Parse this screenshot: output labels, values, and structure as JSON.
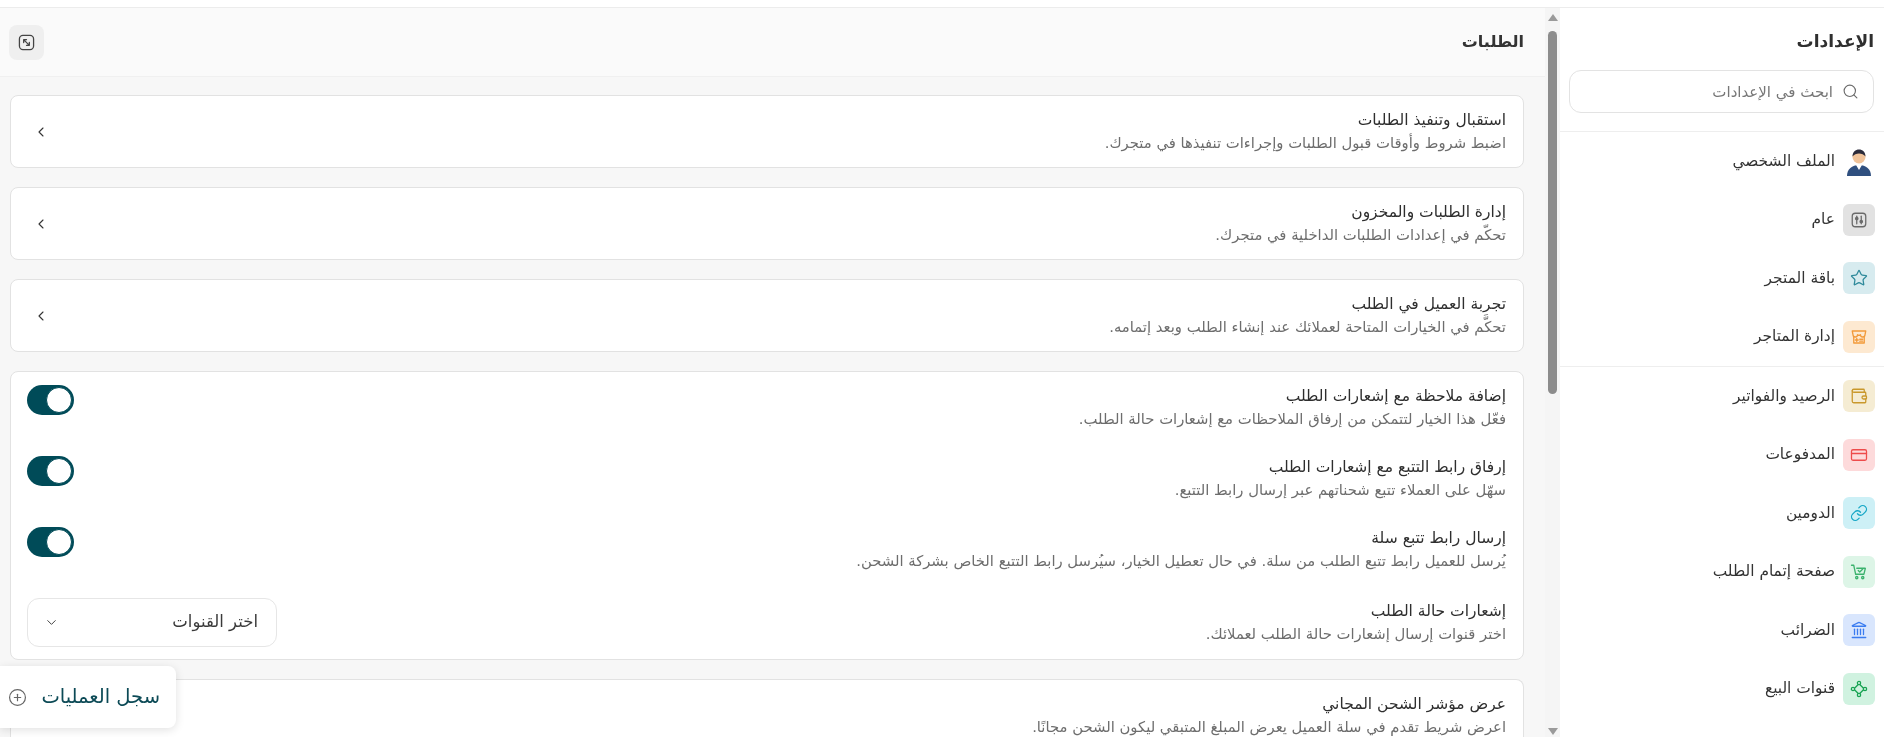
{
  "sidebar": {
    "title": "الإعدادات",
    "search": {
      "placeholder": "ابحث في الإعدادات"
    },
    "groups": [
      {
        "items": [
          {
            "label": "الملف الشخصي",
            "kind": "avatar",
            "selected": false
          },
          {
            "label": "عام",
            "kind": "tile",
            "color": "#e2e2e2",
            "selected": false
          },
          {
            "label": "باقة المتجر",
            "kind": "tile",
            "color": "#d7ebef",
            "selected": false
          },
          {
            "label": "إدارة المتاجر",
            "kind": "tile",
            "color": "#fde9d1",
            "selected": false
          }
        ]
      },
      {
        "items": [
          {
            "label": "الرصيد والفواتير",
            "kind": "tile",
            "color": "#f5ecd3",
            "selected": false
          },
          {
            "label": "المدفوعات",
            "kind": "tile",
            "color": "#fddadb",
            "selected": false
          },
          {
            "label": "الدومين",
            "kind": "tile",
            "color": "#cdf0f6",
            "selected": false
          },
          {
            "label": "صفحة إتمام الطلب",
            "kind": "tile",
            "color": "#ddf5e7",
            "selected": false
          },
          {
            "label": "الضرائب",
            "kind": "tile",
            "color": "#d9e6fd",
            "selected": false
          },
          {
            "label": "قنوات البيع",
            "kind": "tile",
            "color": "#d0f2e0",
            "selected": false
          }
        ]
      }
    ]
  },
  "main": {
    "title": "الطلبات",
    "sections": [
      {
        "kind": "link",
        "title": "استقبال وتنفيذ الطلبات",
        "description": "اضبط شروط وأوقات قبول الطلبات وإجراءات تنفيذها في متجرك."
      },
      {
        "kind": "link",
        "title": "إدارة الطلبات والمخزون",
        "description": "تحكّم في إعدادات الطلبات الداخلية في متجرك."
      },
      {
        "kind": "link",
        "title": "تجربة العميل في الطلب",
        "description": "تحكَّم في الخيارات المتاحة لعملائك عند إنشاء الطلب وبعد إتمامه."
      },
      {
        "kind": "group",
        "rows": [
          {
            "kind": "toggle",
            "title": "إضافة ملاحظة مع إشعارات الطلب",
            "description": "فعّل هذا الخيار لتتمكن من إرفاق الملاحظات مع إشعارات حالة الطلب.",
            "on": true
          },
          {
            "kind": "toggle",
            "title": "إرفاق رابط التتبع مع إشعارات الطلب",
            "description": "سهّل على العملاء تتبع شحناتهم عبر إرسال رابط التتبع.",
            "on": true
          },
          {
            "kind": "toggle",
            "title": "إرسال رابط تتبع سلة",
            "description": "يُرسل للعميل رابط تتبع الطلب من سلة. في حال تعطيل الخيار، سيُرسل رابط التتبع الخاص بشركة الشحن.",
            "on": true
          },
          {
            "kind": "select",
            "title": "إشعارات حالة الطلب",
            "description": "اختر قنوات إرسال إشعارات حالة الطلب لعملائك.",
            "placeholder": "اختر القنوات"
          }
        ]
      },
      {
        "kind": "plain",
        "title": "عرض مؤشر الشحن المجاني",
        "description": "اعرض شريط تقدم في سلة العميل يعرض المبلغ المتبقي ليكون الشحن مجانًا."
      }
    ]
  },
  "activity_button": {
    "label": "سجل العمليات"
  }
}
